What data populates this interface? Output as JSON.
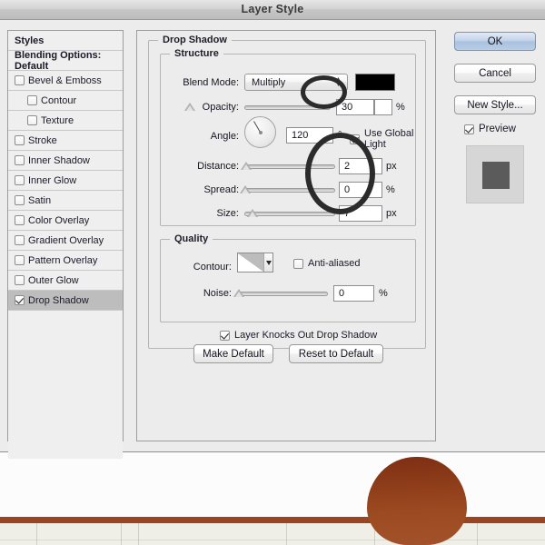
{
  "window": {
    "title": "Layer Style"
  },
  "sidebar": {
    "items": [
      {
        "label": "Styles",
        "type": "header",
        "checkbox": false,
        "indent": false,
        "selected": false
      },
      {
        "label": "Blending Options: Default",
        "type": "header",
        "checkbox": false,
        "indent": false,
        "selected": false
      },
      {
        "label": "Bevel & Emboss",
        "type": "effect",
        "checkbox": true,
        "checked": false,
        "indent": false,
        "selected": false
      },
      {
        "label": "Contour",
        "type": "effect",
        "checkbox": true,
        "checked": false,
        "indent": true,
        "selected": false
      },
      {
        "label": "Texture",
        "type": "effect",
        "checkbox": true,
        "checked": false,
        "indent": true,
        "selected": false
      },
      {
        "label": "Stroke",
        "type": "effect",
        "checkbox": true,
        "checked": false,
        "indent": false,
        "selected": false
      },
      {
        "label": "Inner Shadow",
        "type": "effect",
        "checkbox": true,
        "checked": false,
        "indent": false,
        "selected": false
      },
      {
        "label": "Inner Glow",
        "type": "effect",
        "checkbox": true,
        "checked": false,
        "indent": false,
        "selected": false
      },
      {
        "label": "Satin",
        "type": "effect",
        "checkbox": true,
        "checked": false,
        "indent": false,
        "selected": false
      },
      {
        "label": "Color Overlay",
        "type": "effect",
        "checkbox": true,
        "checked": false,
        "indent": false,
        "selected": false
      },
      {
        "label": "Gradient Overlay",
        "type": "effect",
        "checkbox": true,
        "checked": false,
        "indent": false,
        "selected": false
      },
      {
        "label": "Pattern Overlay",
        "type": "effect",
        "checkbox": true,
        "checked": false,
        "indent": false,
        "selected": false
      },
      {
        "label": "Outer Glow",
        "type": "effect",
        "checkbox": true,
        "checked": false,
        "indent": false,
        "selected": false
      },
      {
        "label": "Drop Shadow",
        "type": "effect",
        "checkbox": true,
        "checked": true,
        "indent": false,
        "selected": true
      }
    ]
  },
  "main": {
    "group_title": "Drop Shadow",
    "structure": {
      "title": "Structure",
      "blend_mode_label": "Blend Mode:",
      "blend_mode_value": "Multiply",
      "blend_color": "#000000",
      "opacity_label": "Opacity:",
      "opacity_value": "30",
      "opacity_unit": "%",
      "angle_label": "Angle:",
      "angle_value": "120",
      "angle_unit": "°",
      "use_global_light_label": "Use Global Light",
      "use_global_light_checked": true,
      "distance_label": "Distance:",
      "distance_value": "2",
      "distance_unit": "px",
      "spread_label": "Spread:",
      "spread_value": "0",
      "spread_unit": "%",
      "size_label": "Size:",
      "size_value": "7",
      "size_unit": "px"
    },
    "quality": {
      "title": "Quality",
      "contour_label": "Contour:",
      "anti_aliased_label": "Anti-aliased",
      "anti_aliased_checked": false,
      "noise_label": "Noise:",
      "noise_value": "0",
      "noise_unit": "%"
    },
    "knockout_label": "Layer Knocks Out Drop Shadow",
    "knockout_checked": true,
    "make_default_label": "Make Default",
    "reset_default_label": "Reset to Default"
  },
  "actions": {
    "ok_label": "OK",
    "cancel_label": "Cancel",
    "new_style_label": "New Style...",
    "preview_label": "Preview",
    "preview_checked": true
  },
  "colors": {
    "window_bg": "#ececec",
    "selected_row": "#bdbdbd",
    "default_button": "#a9c2e0",
    "annotation_ring": "#2b2b2b",
    "photo_blob": "#8b3a18",
    "photo_stripe": "#9b4420",
    "photo_floor": "#f0efe7"
  }
}
